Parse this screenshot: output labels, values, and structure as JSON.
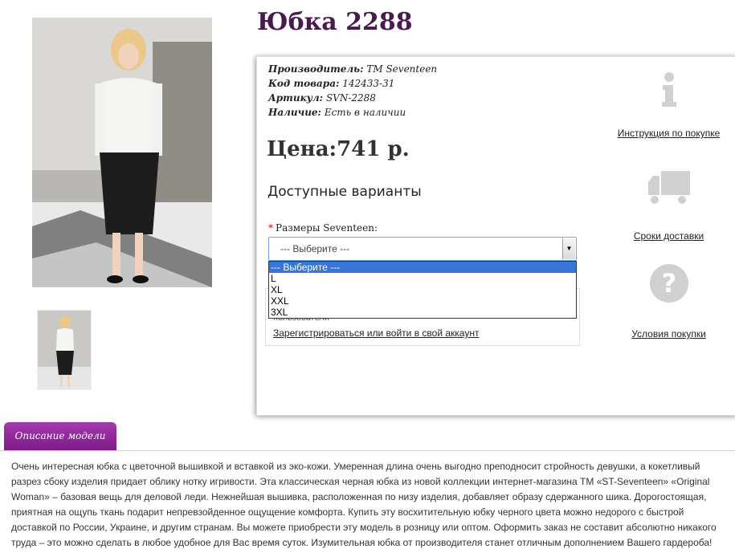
{
  "product": {
    "title": "Юбка 2288",
    "manufacturer_label": "Производитель:",
    "manufacturer": "ТМ Seventeen",
    "code_label": "Код товара:",
    "code": "142433-31",
    "article_label": "Артикул:",
    "article": "SVN-2288",
    "availability_label": "Наличие:",
    "availability": "Есть в наличии",
    "price": "Цена:741 р."
  },
  "options": {
    "heading": "Доступные варианты",
    "size_label": "Размеры Seventeen:",
    "select_value": "--- Выберите ---",
    "dropdown": [
      "--- Выберите ---",
      "L",
      "XL",
      "XXL",
      "3XL"
    ]
  },
  "login": {
    "users_text": "пользователи",
    "link": "Зарегистрироваться или войти в свой аккаунт"
  },
  "side": {
    "instructions": "Инструкция по покупке",
    "delivery": "Сроки доставки",
    "conditions": "Условия покупки"
  },
  "tab": {
    "label": "Описание модели"
  },
  "description": "Очень интересная юбка с цветочной вышивкой и вставкой из эко-кожи. Умеренная длина очень выгодно преподносит стройность девушки, а кокетливый разрез сбоку изделия придает облику нотку игривости. Эта классическая черная юбка из новой коллекции интернет-магазина ТМ «ST-Seventeen» «Original Woman» – базовая вещь для деловой леди. Нежнейшая вышивка, расположенная по низу изделия, добавляет образу сдержанного шика. Дорогостоящая, приятная на ощупь ткань подарит непревзойденное ощущение комфорта. Купить эту восхитительную юбку черного цвета можно недорого с быстрой доставкой по России, Украине, и другим странам. Вы можете приобрести эту модель в розницу или оптом. Оформить заказ не составит абсолютно никакого труда – это можно сделать в любое удобное для Вас время суток. Изумительная юбка от производителя станет отличным дополнением Вашего гардероба!",
  "colors": {
    "title": "#4a1a4e",
    "tab": "#8e2a9b",
    "select_border": "#6fa8dc",
    "dropdown_selected": "#3875d7"
  }
}
